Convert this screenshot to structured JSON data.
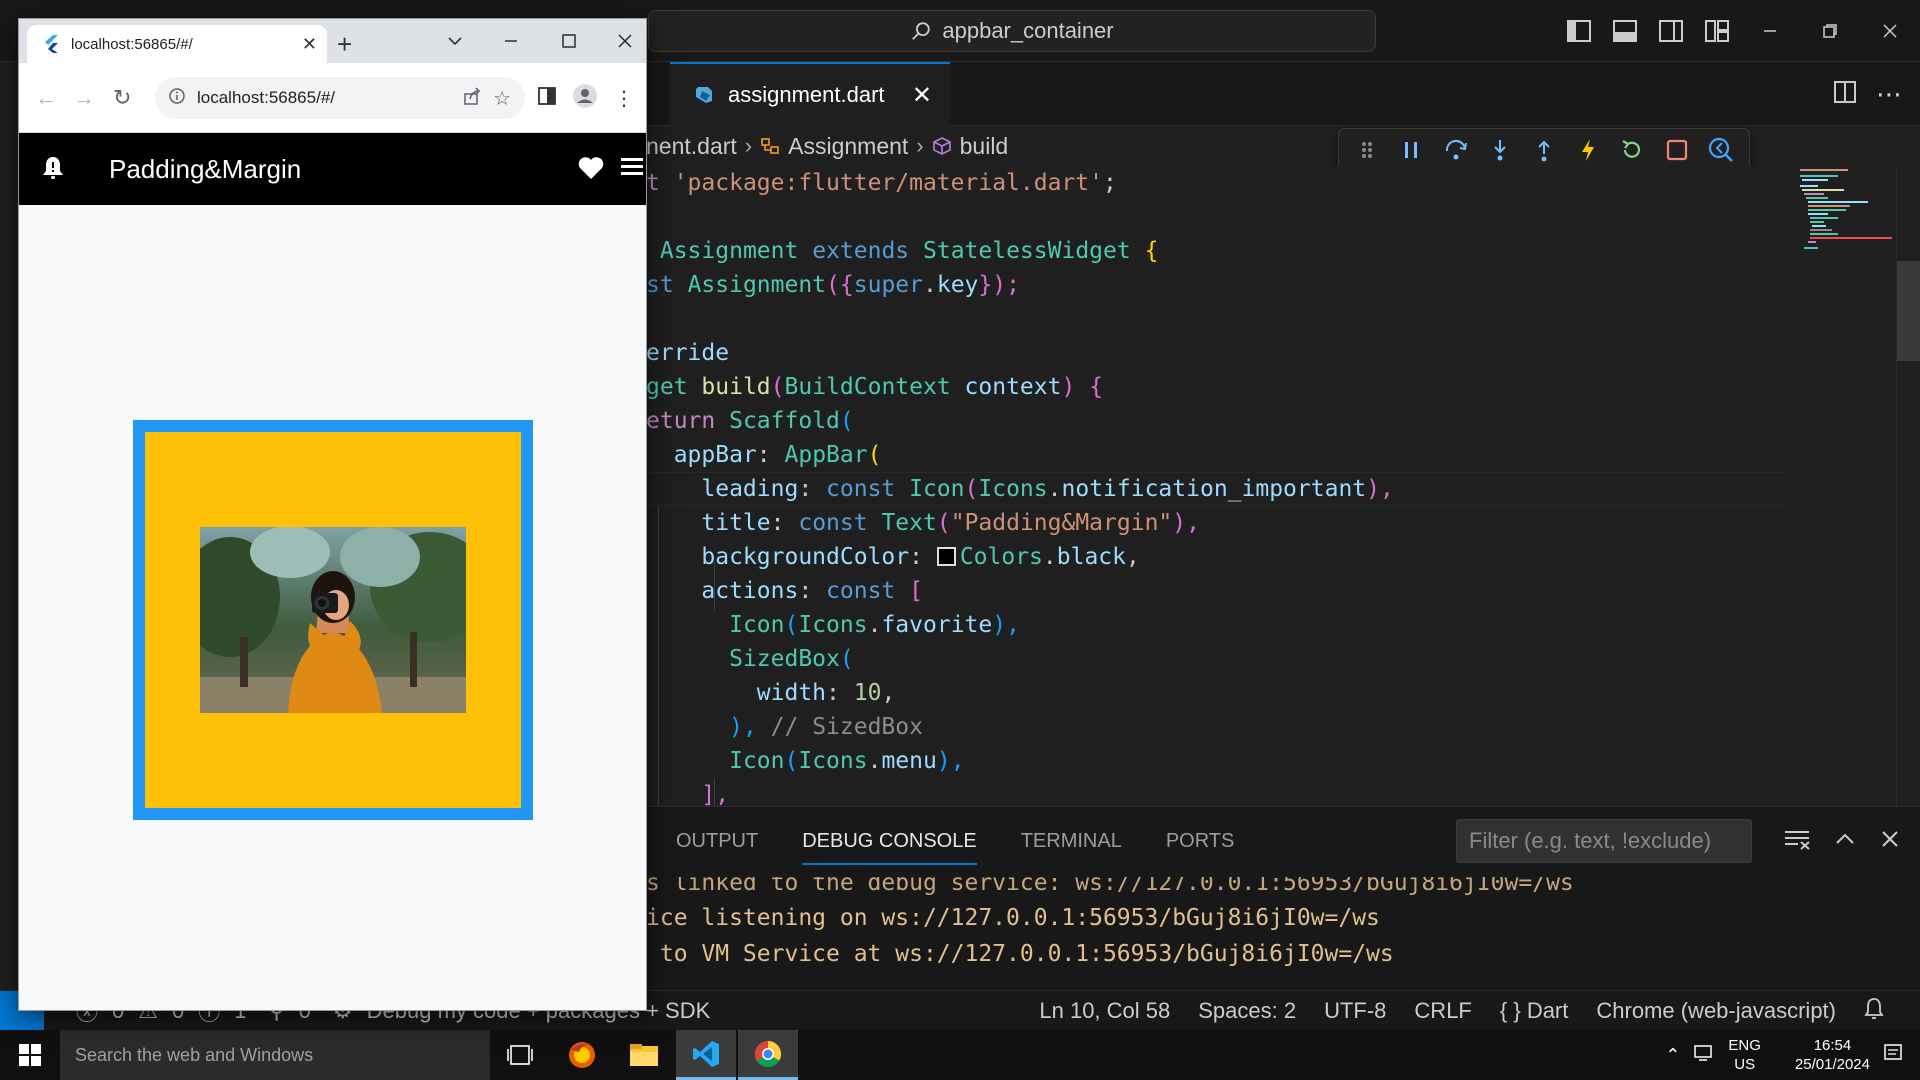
{
  "vscode": {
    "command_center": "appbar_container",
    "tab": {
      "label": "assignment.dart"
    },
    "breadcrumb": {
      "file": "nent.dart",
      "class_name": "Assignment",
      "method": "build"
    },
    "code": {
      "l1_a": "t ",
      "l1_str": "'package:flutter/material.dart'",
      "l1_semi": ";",
      "l3_class": "Assignment",
      "l3_extends": "extends",
      "l3_base": "StatelessWidget",
      "l3_brace": "{",
      "l4_const": "st",
      "l4_name": "Assignment",
      "l4_open": "({",
      "l4_super": "super",
      "l4_dot": ".",
      "l4_key": "key",
      "l4_close": "});",
      "l6": "erride",
      "l7_type": "get",
      "l7_fn": "build",
      "l7_open": "(",
      "l7_ctx_type": "BuildContext",
      "l7_ctx": "context",
      "l7_close": ")",
      "l7_brace": "{",
      "l8_ret": "eturn",
      "l8_cls": "Scaffold",
      "l8_open": "(",
      "l9_prop": "appBar",
      "l9_colon": ": ",
      "l9_cls": "AppBar",
      "l9_open": "(",
      "l10_prop": "leading",
      "l10_colon": ": ",
      "l10_const": "const",
      "l10_cls": "Icon",
      "l10_open": "(",
      "l10_icons": "Icons",
      "l10_dot": ".",
      "l10_name": "notification_important",
      "l10_close": "),",
      "l11_prop": "title",
      "l11_colon": ": ",
      "l11_const": "const",
      "l11_cls": "Text",
      "l11_open": "(",
      "l11_str": "\"Padding&Margin\"",
      "l11_close": "),",
      "l12_prop": "backgroundColor",
      "l12_colon": ": ",
      "l12_cls": "Colors",
      "l12_dot": ".",
      "l12_name": "black",
      "l12_comma": ",",
      "l13_prop": "actions",
      "l13_colon": ": ",
      "l13_const": "const",
      "l13_open": "[",
      "l14_cls": "Icon",
      "l14_open": "(",
      "l14_icons": "Icons",
      "l14_dot": ".",
      "l14_name": "favorite",
      "l14_close": "),",
      "l15_cls": "SizedBox",
      "l15_open": "(",
      "l16_prop": "width",
      "l16_colon": ": ",
      "l16_num": "10",
      "l16_comma": ",",
      "l17_close": "),",
      "l17_comment": "// SizedBox",
      "l18_cls": "Icon",
      "l18_open": "(",
      "l18_icons": "Icons",
      "l18_dot": ".",
      "l18_name": "menu",
      "l18_close": "),",
      "l19": "],"
    },
    "panel": {
      "tabs": [
        "OUTPUT",
        "DEBUG CONSOLE",
        "TERMINAL",
        "PORTS"
      ],
      "filter_placeholder": "Filter (e.g. text, !exclude)",
      "console": [
        "s linked to the debug service: ws://127.0.0.1:56953/bGuj8i6jI0w=/ws",
        "ice listening on ws://127.0.0.1:56953/bGuj8i6jI0w=/ws",
        " to VM Service at ws://127.0.0.1:56953/bGuj8i6jI0w=/ws"
      ]
    },
    "status": {
      "errors": "0",
      "warnings": "0",
      "info": "1",
      "ports": "0",
      "debug_label": "Debug my code + packages + SDK",
      "position": "Ln 10, Col 58",
      "spaces": "Spaces: 2",
      "encoding": "UTF-8",
      "eol": "CRLF",
      "language": "Dart",
      "device": "Chrome (web-javascript)"
    }
  },
  "chrome": {
    "tab_title": "localhost:56865/#/",
    "address": "localhost:56865/#/",
    "app": {
      "appbar_title": "Padding&Margin",
      "colors": {
        "appbar": "#000000",
        "outer": "#2196f3",
        "inner": "#ffc107"
      }
    }
  },
  "taskbar": {
    "search_placeholder": "Search the web and Windows",
    "lang_top": "ENG",
    "lang_bottom": "US",
    "time": "16:54",
    "date": "25/01/2024"
  }
}
